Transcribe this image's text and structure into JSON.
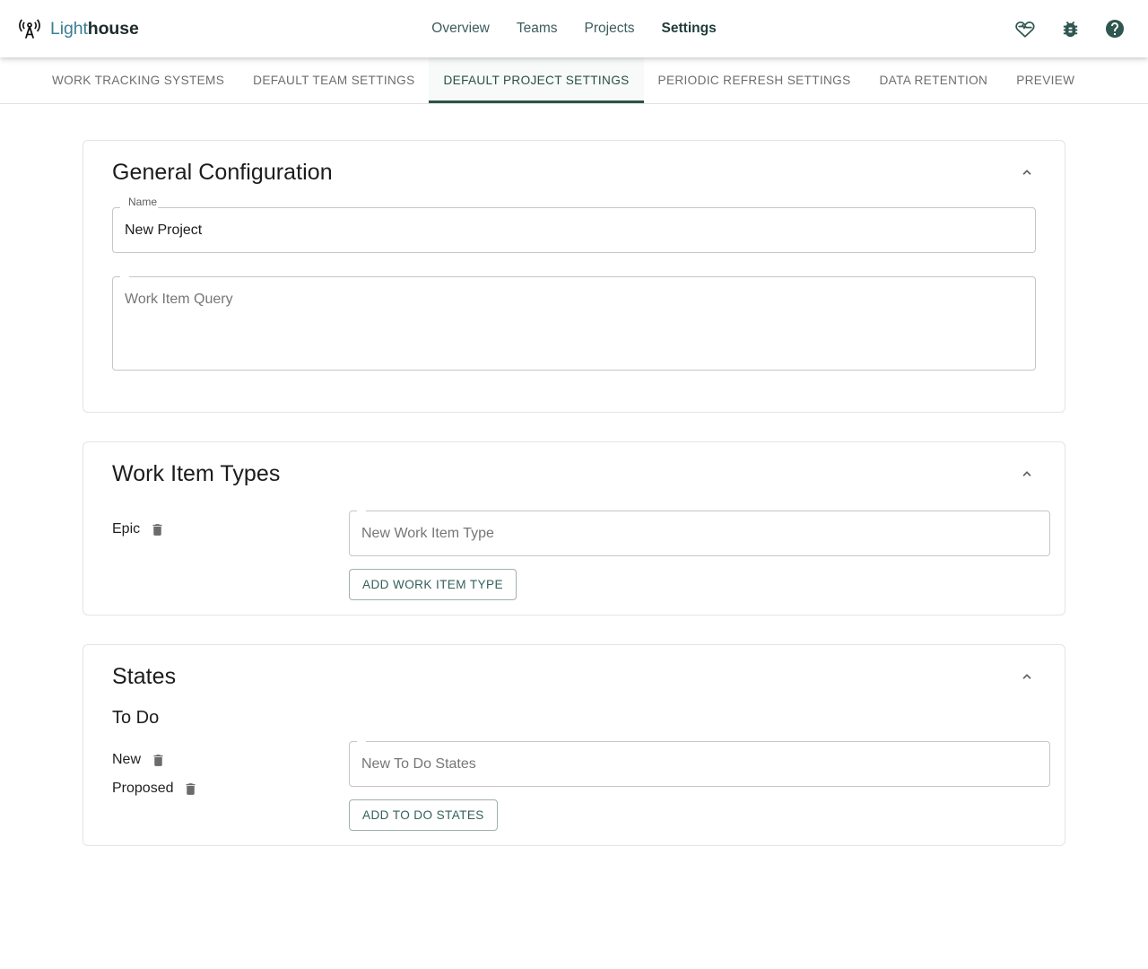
{
  "header": {
    "brand": {
      "light": "Light",
      "house": "house",
      "logo_icon": "broadcast-tower-icon"
    },
    "nav": [
      {
        "label": "Overview",
        "active": false
      },
      {
        "label": "Teams",
        "active": false
      },
      {
        "label": "Projects",
        "active": false
      },
      {
        "label": "Settings",
        "active": true
      }
    ],
    "actions": [
      {
        "name": "sponsor-icon",
        "title": "Sponsor"
      },
      {
        "name": "bug-icon",
        "title": "Report a Bug"
      },
      {
        "name": "help-icon",
        "title": "Help"
      }
    ]
  },
  "tabs": [
    {
      "label": "WORK TRACKING SYSTEMS",
      "active": false
    },
    {
      "label": "DEFAULT TEAM SETTINGS",
      "active": false
    },
    {
      "label": "DEFAULT PROJECT SETTINGS",
      "active": true
    },
    {
      "label": "PERIODIC REFRESH SETTINGS",
      "active": false
    },
    {
      "label": "DATA RETENTION",
      "active": false
    },
    {
      "label": "PREVIEW",
      "active": false
    }
  ],
  "general_configuration": {
    "title": "General Configuration",
    "name_field": {
      "label": "Name",
      "value": "New Project"
    },
    "query_field": {
      "placeholder": "Work Item Query",
      "value": ""
    }
  },
  "work_item_types": {
    "title": "Work Item Types",
    "items": [
      {
        "label": "Epic"
      }
    ],
    "input": {
      "placeholder": "New Work Item Type",
      "value": ""
    },
    "add_button": "ADD WORK ITEM TYPE"
  },
  "states": {
    "title": "States",
    "groups": [
      {
        "title": "To Do",
        "items": [
          {
            "label": "New"
          },
          {
            "label": "Proposed"
          }
        ],
        "input": {
          "placeholder": "New To Do States",
          "value": ""
        },
        "add_button": "ADD TO DO STATES"
      }
    ]
  },
  "colors": {
    "accent": "#2d5249",
    "brand_light": "#3b7f93",
    "brand_dark": "#1d2b2b",
    "tab_inactive": "#6d6d6d",
    "border": "#e4e4e4"
  }
}
